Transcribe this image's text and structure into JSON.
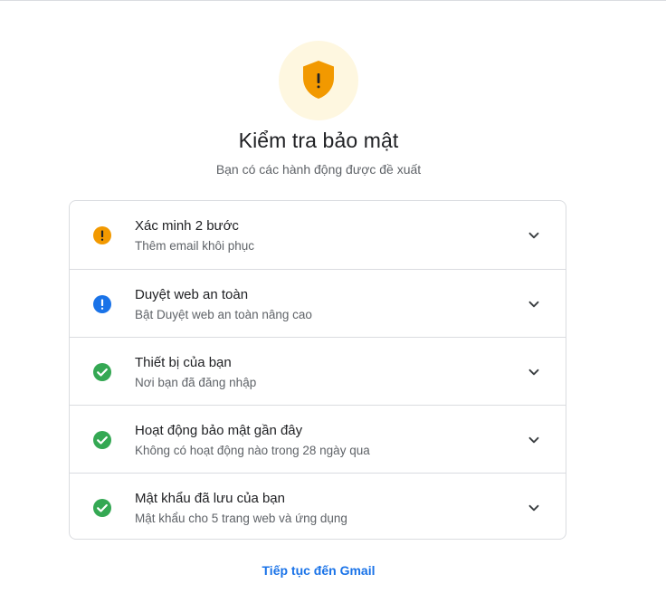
{
  "header": {
    "title": "Kiểm tra bảo mật",
    "subtitle": "Bạn có các hành động được đề xuất",
    "icon": "shield-warning-icon",
    "accent_color": "#f29900",
    "circle_color": "#fef7e0"
  },
  "checks": [
    {
      "title": "Xác minh 2 bước",
      "subtitle": "Thêm email khôi phục",
      "status": "warning",
      "icon": "warning-icon",
      "color": "#f29900"
    },
    {
      "title": "Duyệt web an toàn",
      "subtitle": "Bật Duyệt web an toàn nâng cao",
      "status": "info",
      "icon": "info-alert-icon",
      "color": "#1a73e8"
    },
    {
      "title": "Thiết bị của bạn",
      "subtitle": "Nơi bạn đã đăng nhập",
      "status": "ok",
      "icon": "check-circle-icon",
      "color": "#34a853"
    },
    {
      "title": "Hoạt động bảo mật gần đây",
      "subtitle": "Không có hoạt động nào trong 28 ngày qua",
      "status": "ok",
      "icon": "check-circle-icon",
      "color": "#34a853"
    },
    {
      "title": "Mật khẩu đã lưu của bạn",
      "subtitle": "Mật khẩu cho 5 trang web và ứng dụng",
      "status": "ok",
      "icon": "check-circle-icon",
      "color": "#34a853"
    }
  ],
  "footer": {
    "continue_label": "Tiếp tục đến Gmail",
    "link_color": "#1a73e8"
  }
}
